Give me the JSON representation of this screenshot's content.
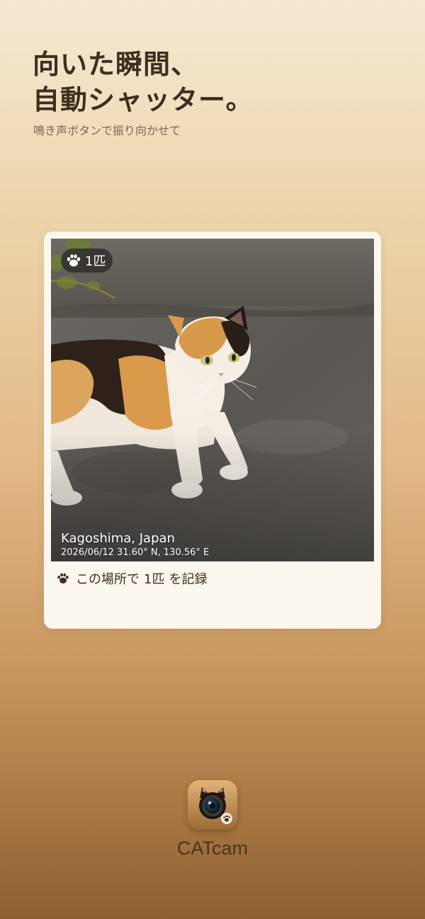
{
  "headline": {
    "line1": "向いた瞬間、",
    "line2": "自動シャッター。"
  },
  "subtitle": "鳴き声ボタンで振り向かせて",
  "card": {
    "badge_count": "1匹",
    "location": "Kagoshima, Japan",
    "coordinates": "2026/06/12  31.60° N, 130.56° E",
    "record_prefix": "この場所で",
    "record_count": "1匹",
    "record_suffix": "を記録"
  },
  "app": {
    "name": "CATcam"
  },
  "colors": {
    "headline": "#3f2e1e",
    "card_background": "#fcf7ee",
    "background_top": "#f5e9d3",
    "background_bottom": "#8e5f31"
  },
  "icons": {
    "badge": "paw-icon",
    "record": "paw-icon",
    "app": "cat-camera-icon"
  }
}
